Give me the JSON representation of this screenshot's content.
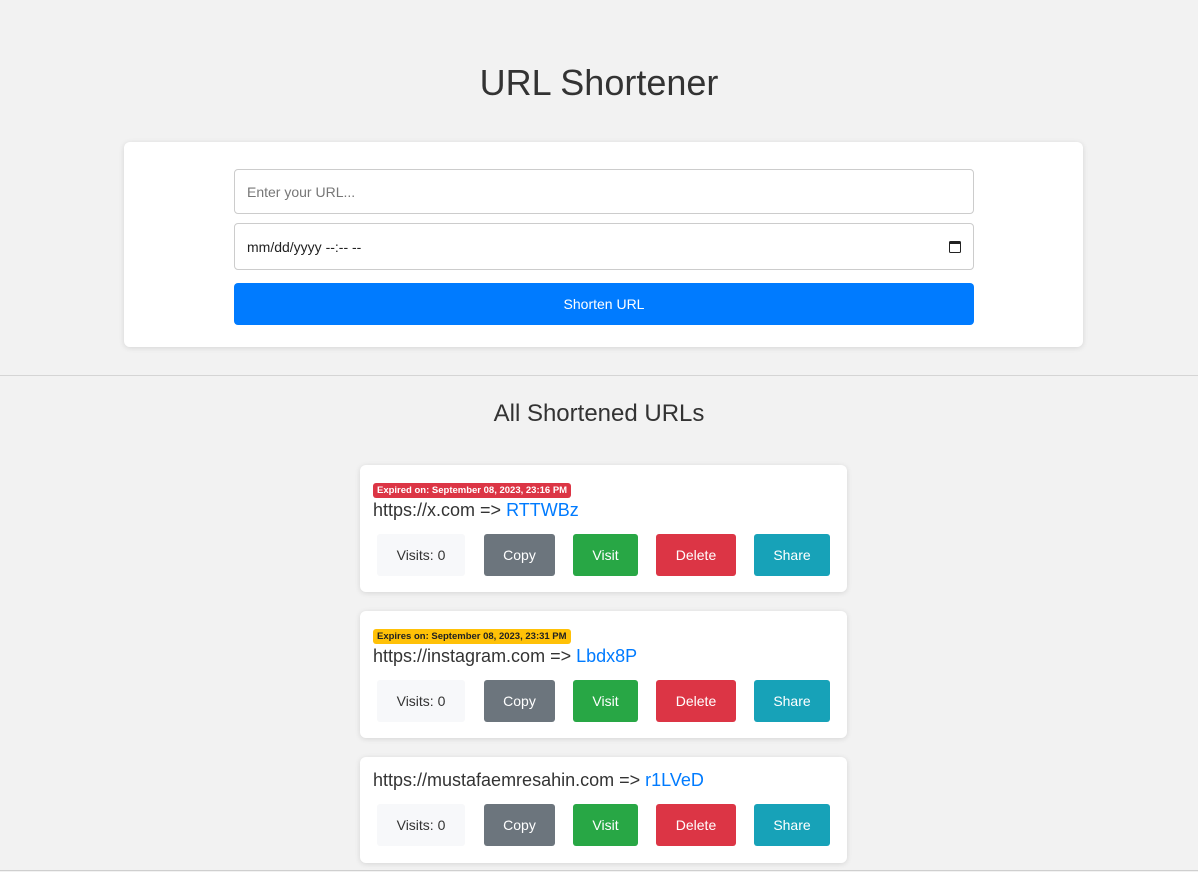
{
  "header": {
    "title": "URL Shortener"
  },
  "form": {
    "url_placeholder": "Enter your URL...",
    "date_placeholder": "mm/dd/yyyy --:-- --",
    "submit_label": "Shorten URL"
  },
  "list": {
    "title": "All Shortened URLs",
    "items": [
      {
        "badge": "Expired on: September 08, 2023, 23:16 PM",
        "badge_type": "expired",
        "original": "https://x.com =>",
        "code": "RTTWBz",
        "visits": "Visits: 0"
      },
      {
        "badge": "Expires on: September 08, 2023, 23:31 PM",
        "badge_type": "expires",
        "original": "https://instagram.com =>",
        "code": "Lbdx8P",
        "visits": "Visits: 0"
      },
      {
        "badge": "",
        "badge_type": "none",
        "original": "https://mustafaemresahin.com =>",
        "code": "r1LVeD",
        "visits": "Visits: 0"
      }
    ]
  },
  "actions": {
    "copy": "Copy",
    "visit": "Visit",
    "delete": "Delete",
    "share": "Share"
  },
  "colors": {
    "primary": "#007bff",
    "copy": "#6c757d",
    "visit": "#28a745",
    "delete": "#dc3545",
    "share": "#17a2b8",
    "expires_badge": "#ffc107"
  },
  "icons": {
    "date_picker": "calendar-icon"
  }
}
